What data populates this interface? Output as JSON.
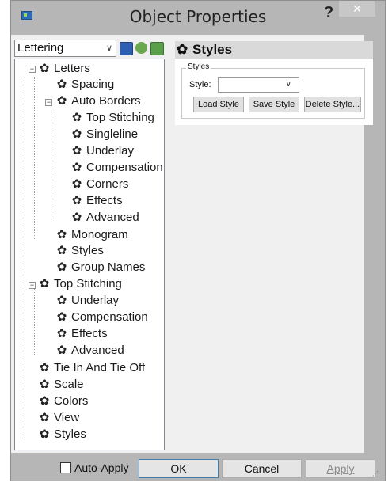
{
  "window": {
    "title": "Object Properties",
    "help_glyph": "?",
    "close_glyph": "✕"
  },
  "toolbar": {
    "category_select": "Lettering",
    "save_icon": "save-icon",
    "gear_icon": "gear-settings-icon",
    "load_icon": "load-icon"
  },
  "tree": {
    "items": [
      {
        "label": "Letters"
      },
      {
        "label": "Spacing"
      },
      {
        "label": "Auto Borders"
      },
      {
        "label": "Top Stitching"
      },
      {
        "label": "Singleline"
      },
      {
        "label": "Underlay"
      },
      {
        "label": "Compensation"
      },
      {
        "label": "Corners"
      },
      {
        "label": "Effects"
      },
      {
        "label": "Advanced"
      },
      {
        "label": "Monogram"
      },
      {
        "label": "Styles"
      },
      {
        "label": "Group Names"
      },
      {
        "label": "Top Stitching"
      },
      {
        "label": "Underlay"
      },
      {
        "label": "Compensation"
      },
      {
        "label": "Effects"
      },
      {
        "label": "Advanced"
      },
      {
        "label": "Tie In And Tie Off"
      },
      {
        "label": "Scale"
      },
      {
        "label": "Colors"
      },
      {
        "label": "View"
      },
      {
        "label": "Styles"
      }
    ]
  },
  "pane": {
    "title": "Styles",
    "group_label": "Styles",
    "style_label": "Style:",
    "style_value": "",
    "load_button": "Load Style",
    "save_button": "Save Style",
    "delete_button": "Delete Style..."
  },
  "footer": {
    "auto_apply_label": "Auto-Apply",
    "auto_apply_checked": false,
    "ok_label": "OK",
    "cancel_label": "Cancel",
    "apply_label": "Apply"
  }
}
